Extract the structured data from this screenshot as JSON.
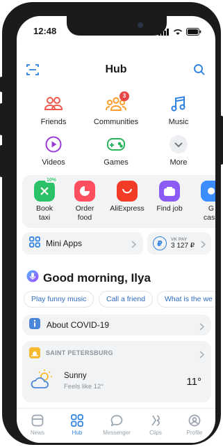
{
  "status": {
    "time": "12:48"
  },
  "header": {
    "title": "Hub"
  },
  "grid": [
    {
      "label": "Friends",
      "icon": "friends-icon"
    },
    {
      "label": "Communities",
      "icon": "communities-icon",
      "badge": "3"
    },
    {
      "label": "Music",
      "icon": "music-icon"
    },
    {
      "label": "Videos",
      "icon": "video-play-icon"
    },
    {
      "label": "Games",
      "icon": "gamepad-icon"
    },
    {
      "label": "More",
      "icon": "chevron-down-icon"
    }
  ],
  "apps": [
    {
      "label": "Book taxi",
      "tag": "10%",
      "color": "#2bc167"
    },
    {
      "label": "Order food",
      "color": "#ff4f5e"
    },
    {
      "label": "AliExpress",
      "color": "#f23c26"
    },
    {
      "label": "Find job",
      "color": "#8a5cf5"
    },
    {
      "label": "G cash",
      "color": "#3b8dff"
    }
  ],
  "mini_apps": {
    "label": "Mini Apps"
  },
  "vk_pay": {
    "title": "VK PAY",
    "amount": "3 127 ₽",
    "symbol": "₽"
  },
  "greeting": {
    "text": "Good morning, Ilya"
  },
  "suggestions": [
    "Play funny music",
    "Call a friend",
    "What is the we"
  ],
  "covid": {
    "label": "About COVID-19"
  },
  "weather": {
    "city": "SAINT PETERSBURG",
    "condition": "Sunny",
    "feels_like": "Feels like 12°",
    "temperature": "11°"
  },
  "tabs": [
    {
      "label": "News",
      "icon": "news-icon",
      "active": false
    },
    {
      "label": "Hub",
      "icon": "hub-grid-icon",
      "active": true
    },
    {
      "label": "Messenger",
      "icon": "message-bubble-icon",
      "active": false
    },
    {
      "label": "Clips",
      "icon": "clips-icon",
      "active": false
    },
    {
      "label": "Profile",
      "icon": "profile-icon",
      "active": false
    }
  ],
  "colors": {
    "accent": "#2d81e0",
    "badge": "#e64646",
    "panel": "#f2f3f5"
  }
}
